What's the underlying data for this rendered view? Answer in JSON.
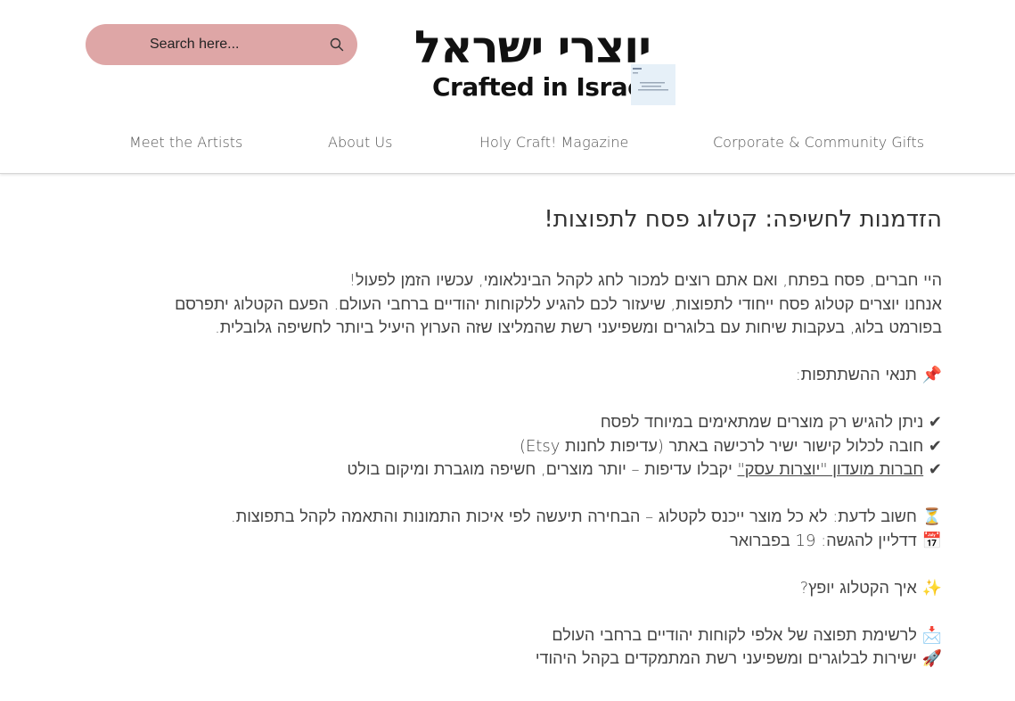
{
  "header": {
    "search": {
      "placeholder": "Search here...",
      "icon": "search-icon"
    },
    "logo": {
      "hebrew": "יוצרי ישראל",
      "english": "Crafted in Israel"
    },
    "nav": [
      {
        "label": "Meet the Artists"
      },
      {
        "label": "About Us"
      },
      {
        "label": "Holy Craft! Magazine"
      },
      {
        "label": "Corporate & Community Gifts"
      }
    ]
  },
  "article": {
    "title": "הזדמנות לחשיפה: קטלוג פסח לתפוצות!",
    "intro1": "היי חברים, פסח בפתח, ואם אתם רוצים למכור לחג לקהל הבינלאומי, עכשיו הזמן לפעול!",
    "intro2": "אנחנו יוצרים קטלוג פסח ייחודי לתפוצות, שיעזור לכם להגיע ללקוחות יהודיים ברחבי העולם. הפעם הקטלוג יתפרסם",
    "intro3": "בפורמט בלוג, בעקבות שיחות עם בלוגרים ומשפיעני רשת שהמליצו שזה הערוץ היעיל ביותר לחשיפה גלובלית.",
    "terms_heading": "📌 תנאי ההשתתפות:",
    "term1": "✔ ניתן להגיש רק מוצרים שמתאימים במיוחד לפסח",
    "term2": "✔ חובה לכלול קישור ישיר לרכישה באתר (עדיפות לחנות Etsy)",
    "term3_prefix": "✔ ",
    "term3_link": "חברות מועדון \"יוצרות עסק\"",
    "term3_suffix": " יקבלו עדיפות – יותר מוצרים, חשיפה מוגברת ומיקום בולט",
    "note_important": "⏳ חשוב לדעת: לא כל מוצר ייכנס לקטלוג – הבחירה תיעשה לפי איכות התמונות והתאמה לקהל בתפוצות.",
    "deadline": "📅 דדליין להגשה: 19 בפברואר",
    "distribution_heading": "✨ איך הקטלוג יופץ?",
    "dist1": "📩 לרשימת תפוצה של אלפי לקוחות יהודיים ברחבי העולם",
    "dist2": "🚀 ישירות לבלוגרים ומשפיעני רשת המתמקדים בקהל היהודי"
  }
}
